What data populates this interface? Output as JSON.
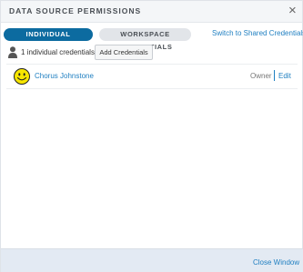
{
  "dialog": {
    "title": "DATA SOURCE PERMISSIONS",
    "close_glyph": "×"
  },
  "tabs": {
    "active_label": "INDIVIDUAL CREDENTIALS",
    "inactive_label": "WORKSPACE CREDENTIALS",
    "switch_link": "Switch to Shared Credentials"
  },
  "summary": {
    "icon": "person-icon",
    "count_text": "1 individual credentials",
    "add_button": "Add Credentials"
  },
  "credentials": [
    {
      "avatar_icon": "smiley-face-icon",
      "name": "Chorus Johnstone",
      "role": "Owner",
      "edit_label": "Edit"
    }
  ],
  "footer": {
    "close_label": "Close Window"
  },
  "colors": {
    "accent_blue": "#0c6ba0",
    "link_blue": "#1f7fc1",
    "footer_bg": "#e3eaf3",
    "avatar_yellow": "#f7e600"
  }
}
